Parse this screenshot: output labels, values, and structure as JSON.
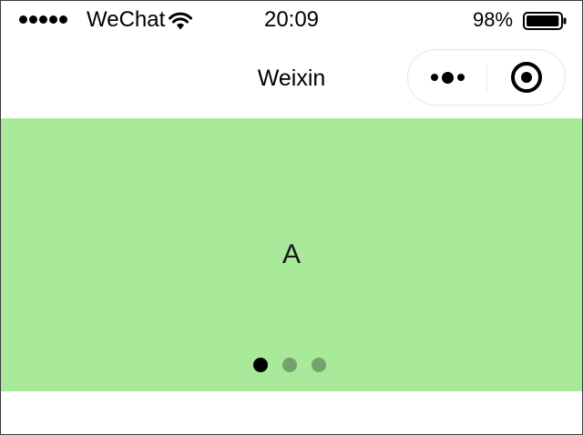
{
  "status_bar": {
    "signal_dots": 5,
    "carrier": "WeChat",
    "time": "20:09",
    "battery_percent": "98%",
    "battery_level": 0.98,
    "wifi_icon": "wifi-icon",
    "battery_icon": "battery-icon"
  },
  "nav_bar": {
    "title": "Weixin",
    "capsule": {
      "more_icon": "more-dots-icon",
      "close_icon": "target-close-icon"
    }
  },
  "swiper": {
    "background_color": "#a8e99a",
    "current_slide_label": "A",
    "slide_count": 3,
    "active_index": 0,
    "indicator_active_color": "#000000",
    "indicator_inactive_color": "rgba(0,0,0,0.3)"
  }
}
